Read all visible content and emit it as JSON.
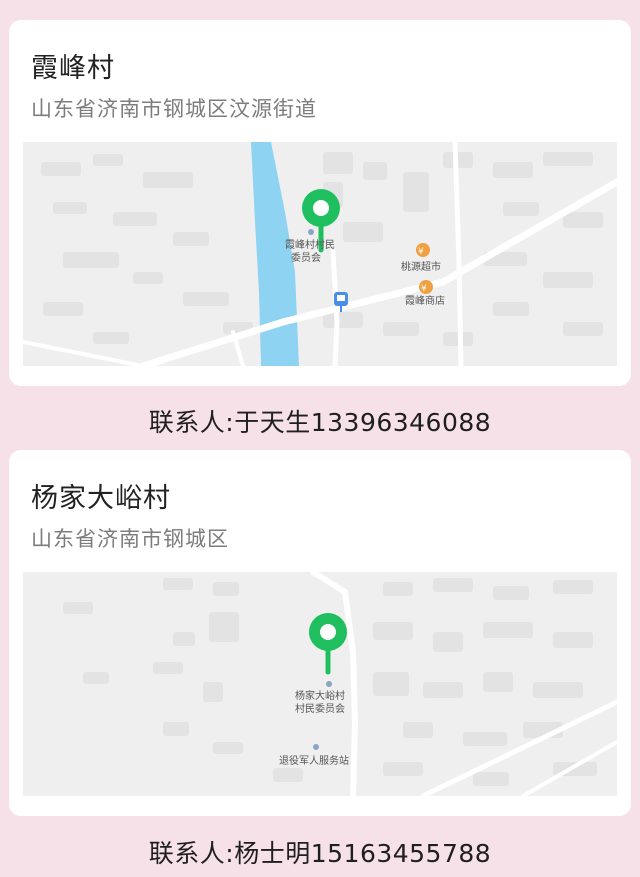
{
  "cards": [
    {
      "title": "霞峰村",
      "address": "山东省济南市钢城区汶源街道",
      "map": {
        "poi_labels": [
          "霞峰村村民",
          "委员会",
          "桃源超市",
          "霞峰商店"
        ]
      },
      "contact": "联系人:于天生13396346088"
    },
    {
      "title": "杨家大峪村",
      "address": "山东省济南市钢城区",
      "map": {
        "poi_labels": [
          "杨家大峪村",
          "村民委员会",
          "退役军人服务站"
        ]
      },
      "contact": "联系人:杨士明15163455788"
    }
  ],
  "colors": {
    "background": "#f6e1e8",
    "pin": "#1fbf5f",
    "river": "#8ed3f2",
    "poi_orange": "#f0a040"
  },
  "icons": [
    "location-pin-icon",
    "shop-icon",
    "bus-stop-icon",
    "poi-dot-icon"
  ]
}
